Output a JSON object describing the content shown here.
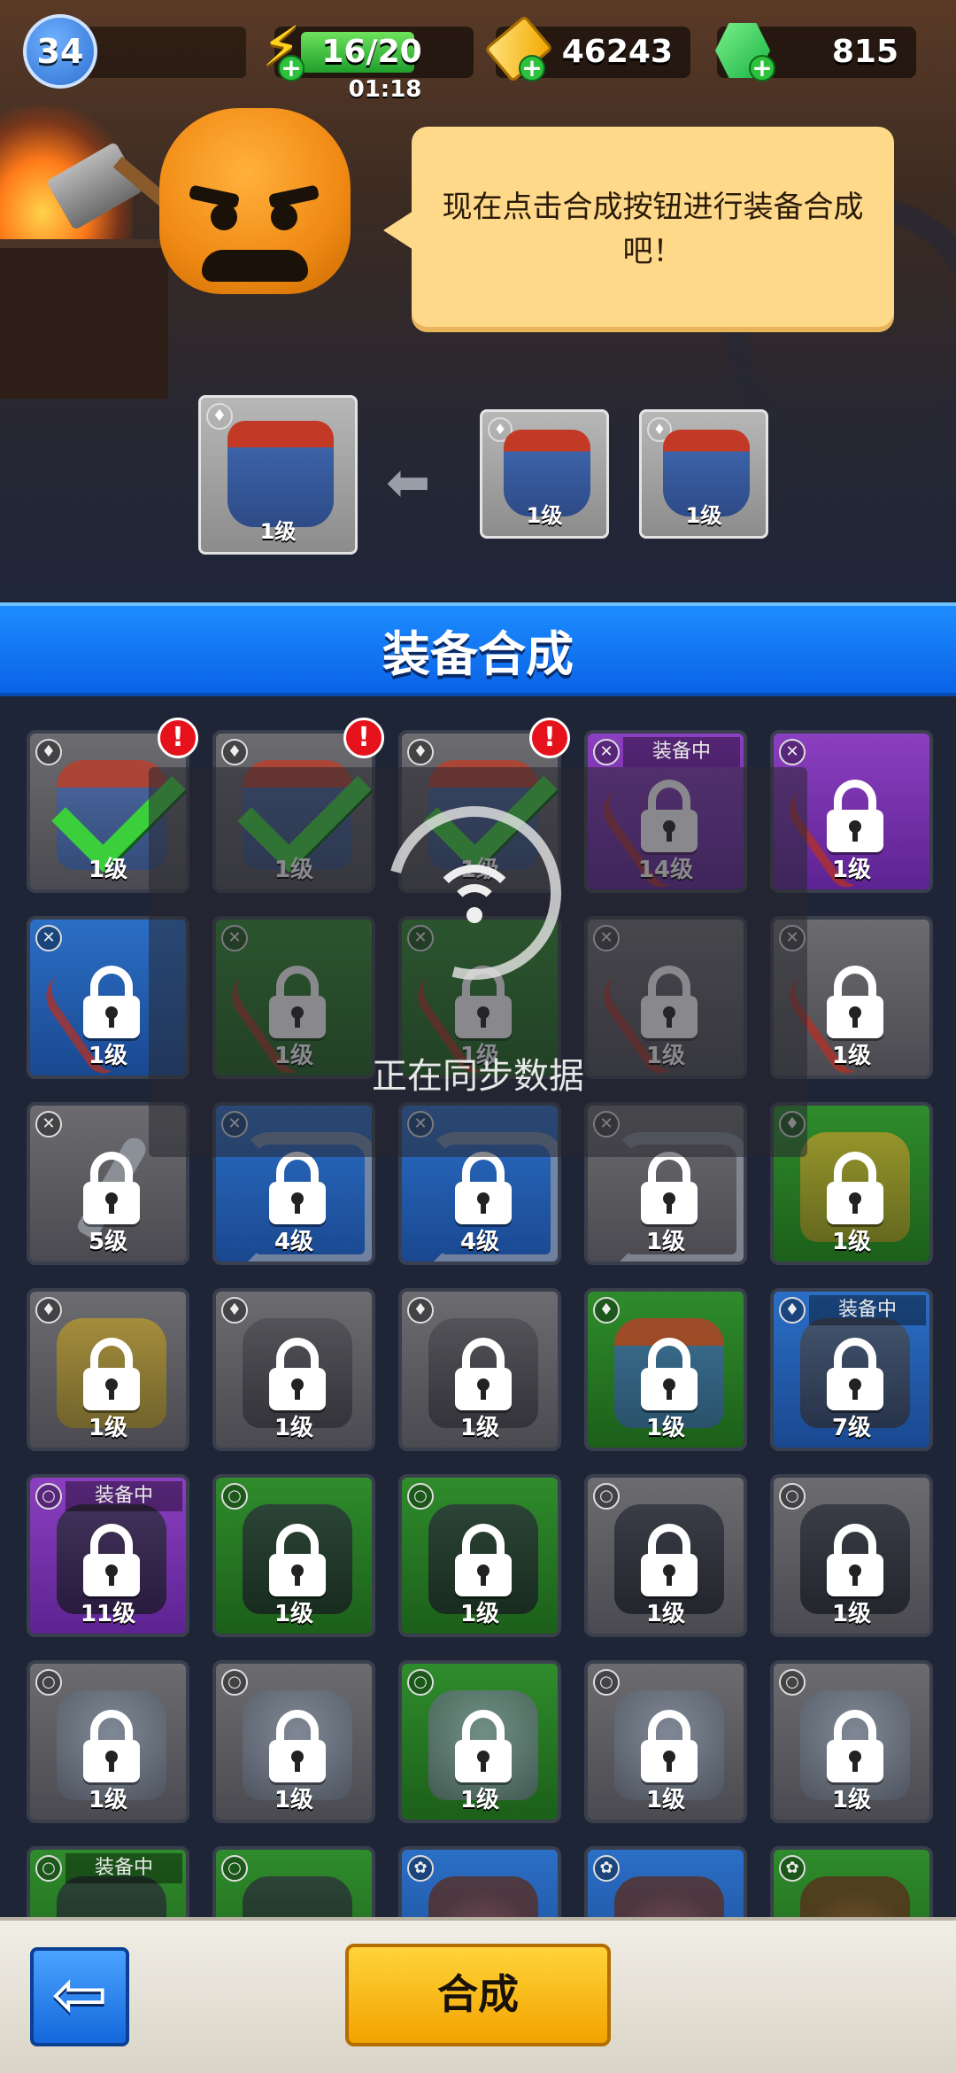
{
  "hud": {
    "player_level": "34",
    "energy": "16/20",
    "energy_fraction": 0.8,
    "energy_timer": "01:18",
    "tickets": "46243",
    "gems": "815"
  },
  "tutorial": {
    "message": "现在点击合成按钮进行装备合成吧！"
  },
  "recipe": {
    "result_level": "1级",
    "input1_level": "1级",
    "input2_level": "1级"
  },
  "section_title": "装备合成",
  "equipped_label": "装备中",
  "sync": {
    "text": "正在同步数据"
  },
  "grid": {
    "cells": [
      {
        "level": "1级",
        "quality": "gray",
        "item": "armor",
        "slot": "armor-icon",
        "state": "check",
        "alert": "!"
      },
      {
        "level": "1级",
        "quality": "gray",
        "item": "armor",
        "slot": "armor-icon",
        "state": "check",
        "alert": "!"
      },
      {
        "level": "1级",
        "quality": "gray",
        "item": "armor",
        "slot": "armor-icon",
        "state": "check",
        "alert": "!"
      },
      {
        "level": "14级",
        "quality": "purple",
        "item": "bow",
        "slot": "bow-icon",
        "state": "lock",
        "equipped": true
      },
      {
        "level": "1级",
        "quality": "purple",
        "item": "bow",
        "slot": "bow-icon",
        "state": "lock"
      },
      {
        "level": "1级",
        "quality": "blue",
        "item": "bow",
        "slot": "bow-icon",
        "state": "lock"
      },
      {
        "level": "1级",
        "quality": "green",
        "item": "bow",
        "slot": "bow-icon",
        "state": "lock"
      },
      {
        "level": "1级",
        "quality": "green",
        "item": "bow",
        "slot": "bow-icon",
        "state": "lock"
      },
      {
        "level": "1级",
        "quality": "gray",
        "item": "bow",
        "slot": "bow-icon",
        "state": "lock"
      },
      {
        "level": "1级",
        "quality": "gray",
        "item": "bow",
        "slot": "bow-icon",
        "state": "lock"
      },
      {
        "level": "5级",
        "quality": "gray",
        "item": "sword",
        "slot": "bow-icon",
        "state": "lock"
      },
      {
        "level": "4级",
        "quality": "blue",
        "item": "hook",
        "slot": "bow-icon",
        "state": "lock"
      },
      {
        "level": "4级",
        "quality": "blue",
        "item": "hook",
        "slot": "bow-icon",
        "state": "lock"
      },
      {
        "level": "1级",
        "quality": "gray",
        "item": "hook",
        "slot": "bow-icon",
        "state": "lock"
      },
      {
        "level": "1级",
        "quality": "green",
        "item": "vest",
        "slot": "armor-icon",
        "state": "lock"
      },
      {
        "level": "1级",
        "quality": "gray",
        "item": "vest",
        "slot": "armor-icon",
        "state": "lock"
      },
      {
        "level": "1级",
        "quality": "gray",
        "item": "dark",
        "slot": "armor-icon",
        "state": "lock"
      },
      {
        "level": "1级",
        "quality": "gray",
        "item": "dark",
        "slot": "armor-icon",
        "state": "lock"
      },
      {
        "level": "1级",
        "quality": "green",
        "item": "armor",
        "slot": "armor-icon",
        "state": "lock"
      },
      {
        "level": "7级",
        "quality": "blue",
        "item": "dark",
        "slot": "armor-icon",
        "state": "lock",
        "equipped": true
      },
      {
        "level": "11级",
        "quality": "purple",
        "item": "shadow",
        "slot": "ring-icon",
        "state": "lock",
        "equipped": true
      },
      {
        "level": "1级",
        "quality": "green",
        "item": "shadow",
        "slot": "ring-icon",
        "state": "lock"
      },
      {
        "level": "1级",
        "quality": "green",
        "item": "shadow",
        "slot": "ring-icon",
        "state": "lock"
      },
      {
        "level": "1级",
        "quality": "gray",
        "item": "shadow",
        "slot": "ring-icon",
        "state": "lock"
      },
      {
        "level": "1级",
        "quality": "gray",
        "item": "shadow",
        "slot": "ring-icon",
        "state": "lock"
      },
      {
        "level": "1级",
        "quality": "gray",
        "item": "wolf",
        "slot": "ring-icon",
        "state": "lock"
      },
      {
        "level": "1级",
        "quality": "gray",
        "item": "wolf",
        "slot": "ring-icon",
        "state": "lock"
      },
      {
        "level": "1级",
        "quality": "green",
        "item": "wolf",
        "slot": "ring-icon",
        "state": "lock"
      },
      {
        "level": "1级",
        "quality": "gray",
        "item": "wolf",
        "slot": "ring-icon",
        "state": "lock"
      },
      {
        "level": "1级",
        "quality": "gray",
        "item": "wolf",
        "slot": "ring-icon",
        "state": "lock"
      },
      {
        "level": "",
        "quality": "green",
        "item": "shadow",
        "slot": "ring-icon",
        "state": "none",
        "equipped": true
      },
      {
        "level": "",
        "quality": "green",
        "item": "shadow",
        "slot": "ring-icon",
        "state": "none"
      },
      {
        "level": "",
        "quality": "blue",
        "item": "mask",
        "slot": "paw-icon",
        "state": "none"
      },
      {
        "level": "",
        "quality": "blue",
        "item": "mask",
        "slot": "paw-icon",
        "state": "none"
      },
      {
        "level": "",
        "quality": "green",
        "item": "mask",
        "slot": "paw-icon",
        "state": "none"
      }
    ]
  },
  "buttons": {
    "back_icon": "⇦",
    "merge_label": "合成"
  },
  "colors": {
    "title_bar": "#0a63e6",
    "merge_button": "#ffc21a",
    "alert": "#e5121c",
    "check": "#3ccf3c"
  }
}
